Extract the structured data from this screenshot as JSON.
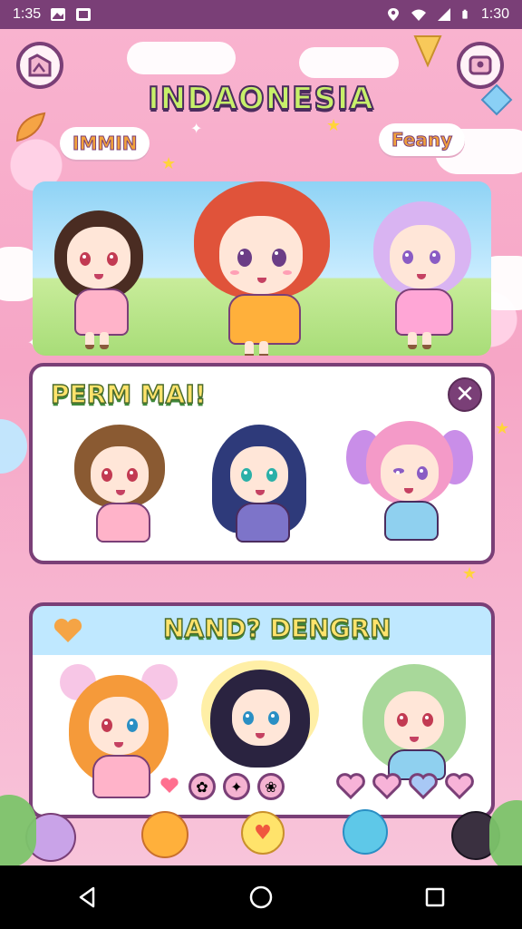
{
  "status_bar": {
    "time_left": "1:35",
    "time_right": "1:30"
  },
  "header": {
    "title": "INDAONESIA"
  },
  "hero": {
    "speech_left": "IMMIN",
    "speech_right": "Feany"
  },
  "panel1": {
    "title": "PERM MAI!",
    "close_label": "✕"
  },
  "panel2": {
    "title": "NAND? DENGRN"
  },
  "icons": {
    "top_left": "gallery-icon",
    "top_right": "profile-card-icon",
    "back": "back-triangle-icon",
    "home": "home-circle-icon",
    "recents": "recents-square-icon"
  },
  "colors": {
    "accent": "#7a3f77",
    "title_fill": "#c7f06a",
    "panel_title_fill": "#ffe36b",
    "background": "#f7a9c6"
  }
}
